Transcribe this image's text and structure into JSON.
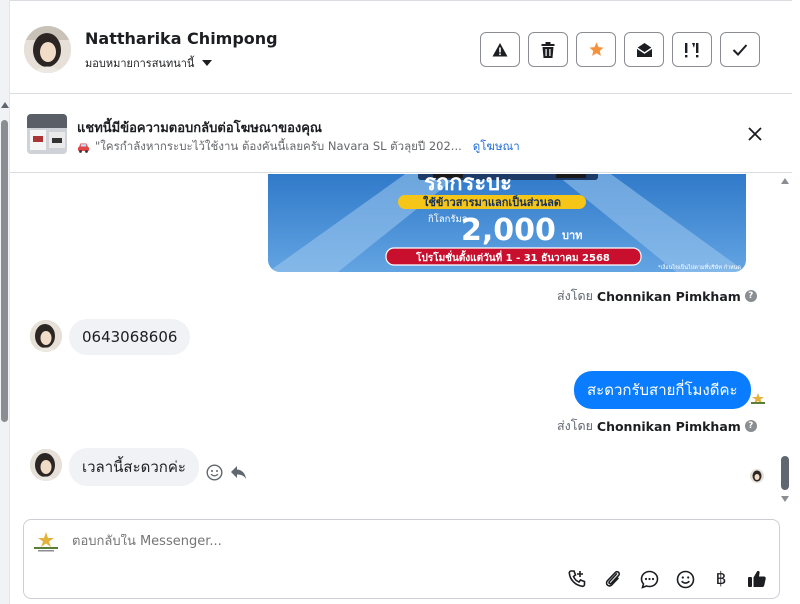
{
  "header": {
    "contact_name": "Nattharika Chimpong",
    "assign_label": "มอบหมายการสนทนานี้",
    "actions": [
      "report",
      "delete",
      "star",
      "mark-read",
      "follow-up",
      "done"
    ]
  },
  "ad_banner": {
    "title": "แชทนี้มีข้อความตอบกลับต่อโฆษณาของคุณ",
    "subtitle": "\"ใครกำลังหากระบะไว้ใช้งาน ต้องคันนี้เลยครับ Navara SL ตัวลุยปี 202...",
    "link": "ดูโฆษณา"
  },
  "promo_image": {
    "line1": "รถกระบะ",
    "line2": "ใช้ข้าวสารมาแลกเป็นส่วนลด",
    "prefix": "กิโลกรัมละ",
    "amount": "2,000",
    "unit": "บาท",
    "period": "โปรโมชั่นตั้งแต่วันที่ 1 - 31 ธันวาคม 2568",
    "fine_print": "*เงื่อนไขเป็นไปตามที่บริษัท กำหนด"
  },
  "messages": [
    {
      "from": "agent",
      "sent_by_prefix": "ส่งโดย",
      "sent_by": "Chonnikan Pimkham"
    },
    {
      "from": "customer",
      "text": "0643068606"
    },
    {
      "from": "agent",
      "text": "สะดวกรับสายกี่โมงดีคะ",
      "sent_by_prefix": "ส่งโดย",
      "sent_by": "Chonnikan Pimkham"
    },
    {
      "from": "customer",
      "text": "เวลานี้สะดวกค่ะ"
    }
  ],
  "composer": {
    "placeholder": "ตอบกลับใน Messenger...",
    "currency_symbol": "฿"
  },
  "colors": {
    "accent": "#0a7cff",
    "star": "#f7923b",
    "link": "#216fdb"
  }
}
